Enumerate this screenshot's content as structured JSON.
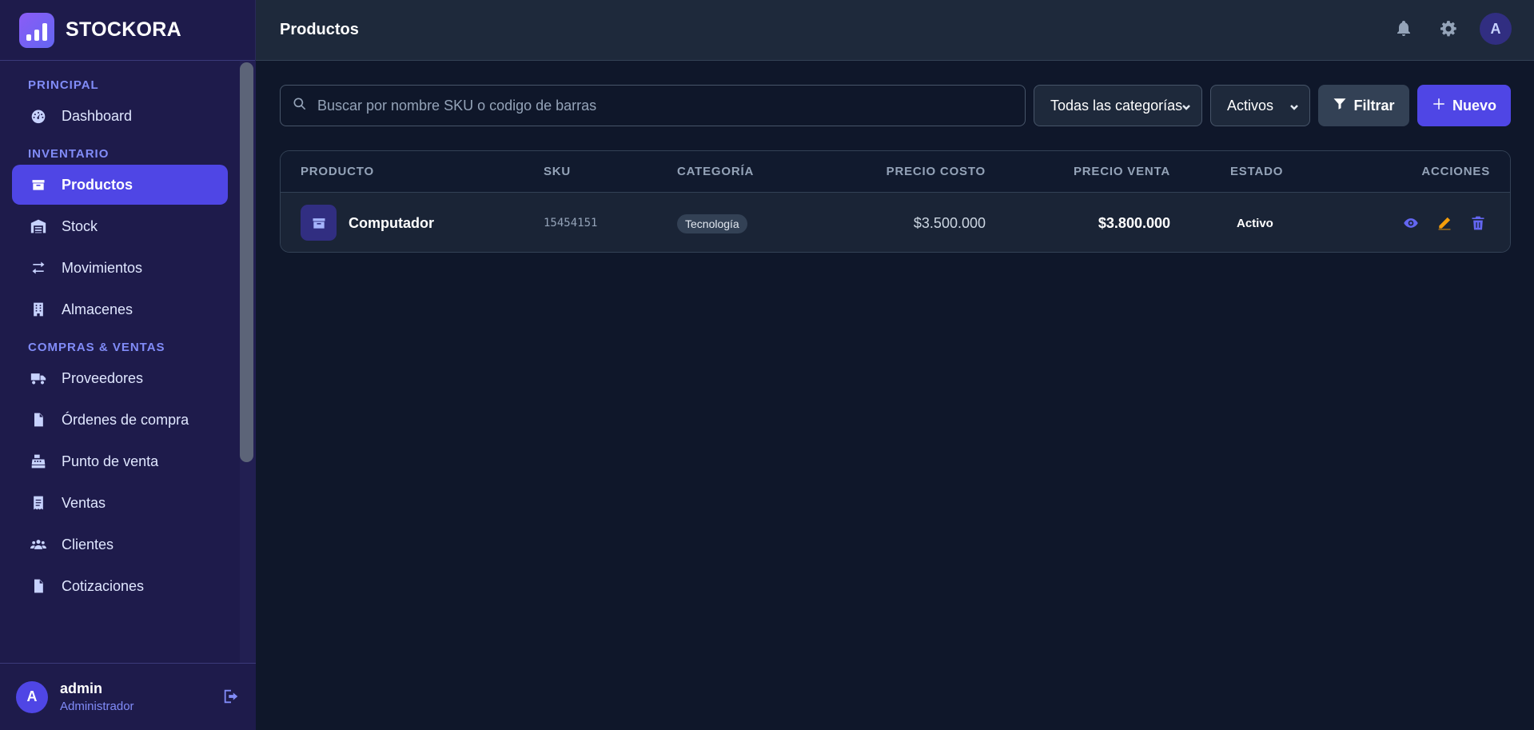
{
  "brand": {
    "name": "STOCKORA",
    "logo_icon": "chart-bars-icon"
  },
  "sidebar": {
    "sections": [
      {
        "label": "PRINCIPAL",
        "items": [
          {
            "label": "Dashboard",
            "icon": "gauge-icon"
          }
        ]
      },
      {
        "label": "INVENTARIO",
        "items": [
          {
            "label": "Productos",
            "icon": "box-icon",
            "active": true
          },
          {
            "label": "Stock",
            "icon": "warehouse-icon"
          },
          {
            "label": "Movimientos",
            "icon": "arrows-exchange-icon"
          },
          {
            "label": "Almacenes",
            "icon": "building-icon"
          }
        ]
      },
      {
        "label": "COMPRAS & VENTAS",
        "items": [
          {
            "label": "Proveedores",
            "icon": "truck-icon"
          },
          {
            "label": "Órdenes de compra",
            "icon": "file-icon"
          },
          {
            "label": "Punto de venta",
            "icon": "cash-register-icon"
          },
          {
            "label": "Ventas",
            "icon": "receipt-icon"
          },
          {
            "label": "Clientes",
            "icon": "users-icon"
          },
          {
            "label": "Cotizaciones",
            "icon": "document-icon"
          }
        ]
      }
    ]
  },
  "user": {
    "initial": "A",
    "name": "admin",
    "role": "Administrador"
  },
  "header": {
    "title": "Productos",
    "avatar_initial": "A"
  },
  "toolbar": {
    "search_placeholder": "Buscar por nombre SKU o codigo de barras",
    "category_select": "Todas las categorías",
    "status_select": "Activos",
    "filter_label": "Filtrar",
    "new_label": "Nuevo"
  },
  "table": {
    "columns": {
      "product": "PRODUCTO",
      "sku": "SKU",
      "category": "CATEGORÍA",
      "cost": "PRECIO COSTO",
      "sale": "PRECIO VENTA",
      "state": "ESTADO",
      "actions": "ACCIONES"
    },
    "rows": [
      {
        "name": "Computador",
        "sku": "15454151",
        "category": "Tecnología",
        "cost": "$3.500.000",
        "sale": "$3.800.000",
        "state": "Activo"
      }
    ]
  },
  "colors": {
    "accent": "#4f46e5",
    "sidebar_bg": "#1e1b4b",
    "main_bg": "#0f172a",
    "edit_action": "#f59e0b"
  }
}
